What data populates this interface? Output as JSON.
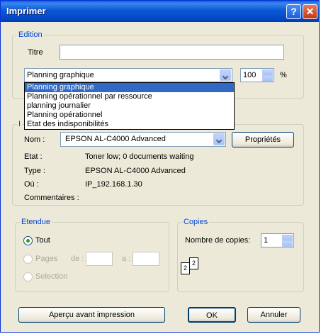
{
  "window": {
    "title": "Imprimer",
    "help": "?",
    "close": "✕"
  },
  "edition": {
    "legend": "Edition",
    "titre_label": "Titre",
    "titre_value": "",
    "report_selected": "Planning graphique",
    "zoom_value": "100",
    "zoom_unit": "%",
    "report_options": [
      "Planning graphique",
      "Planning opérationnel par ressource",
      "planning journalier",
      "Planning opérationnel",
      "Etat des indisponibilités"
    ]
  },
  "printer": {
    "legend": "I",
    "nom_label": "Nom :",
    "nom_value": "EPSON AL-C4000 Advanced",
    "properties_button": "Propriétés",
    "etat_label": "Etat :",
    "etat_value": "Toner low; 0 documents waiting",
    "type_label": "Type :",
    "type_value": "EPSON AL-C4000 Advanced",
    "ou_label": "Où :",
    "ou_value": "IP_192.168.1.30",
    "commentaires_label": "Commentaires :"
  },
  "etendue": {
    "legend": "Etendue",
    "tout": "Tout",
    "pages": "Pages",
    "de": "de :",
    "a": "a :",
    "selection": "Selection"
  },
  "copies": {
    "legend": "Copies",
    "label": "Nombre de copies:",
    "value": "1",
    "collate_pages": [
      "2",
      "2"
    ]
  },
  "buttons": {
    "preview": "Aperçu avant impression",
    "ok": "OK",
    "cancel": "Annuler"
  }
}
